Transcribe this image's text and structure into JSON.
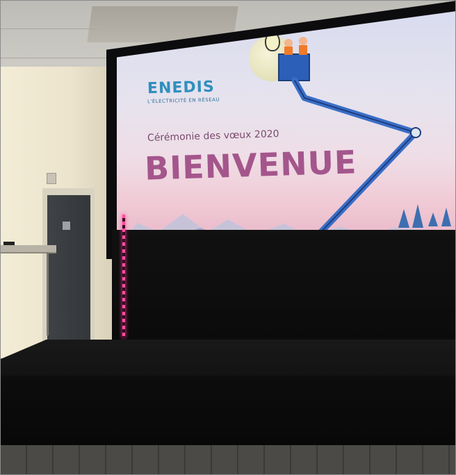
{
  "scene": {
    "description_type": "photo",
    "colors": {
      "brand_blue": "#2f8fbf",
      "headline_purple": "#a4568c",
      "subtitle_purple": "#7a4a6e",
      "led_pink": "#ff4fa0"
    }
  },
  "screen": {
    "logo_text": "ENEDIS",
    "logo_tagline": "L'ÉLECTRICITÉ EN RÉSEAU",
    "subtitle": "Cérémonie des vœux 2020",
    "headline": "BIENVENUE"
  }
}
